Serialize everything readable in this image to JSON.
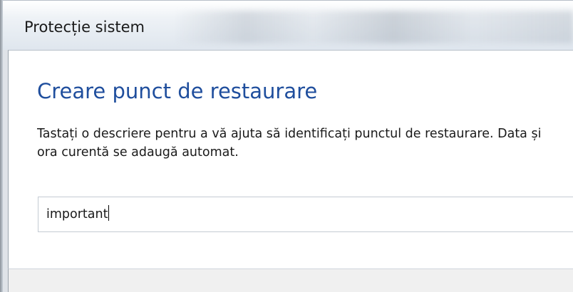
{
  "window": {
    "title": "Protecție sistem"
  },
  "dialog": {
    "heading": "Creare punct de restaurare",
    "description_line1": "Tastați o descriere pentru a vă ajuta să identificați punctul de restaurare. Data și",
    "description_line2": "ora curentă se adaugă automat.",
    "input_value": "important"
  },
  "colors": {
    "heading": "#1f4e9d",
    "content_bg": "#ffffff",
    "footer_bg": "#f0f0f0"
  }
}
